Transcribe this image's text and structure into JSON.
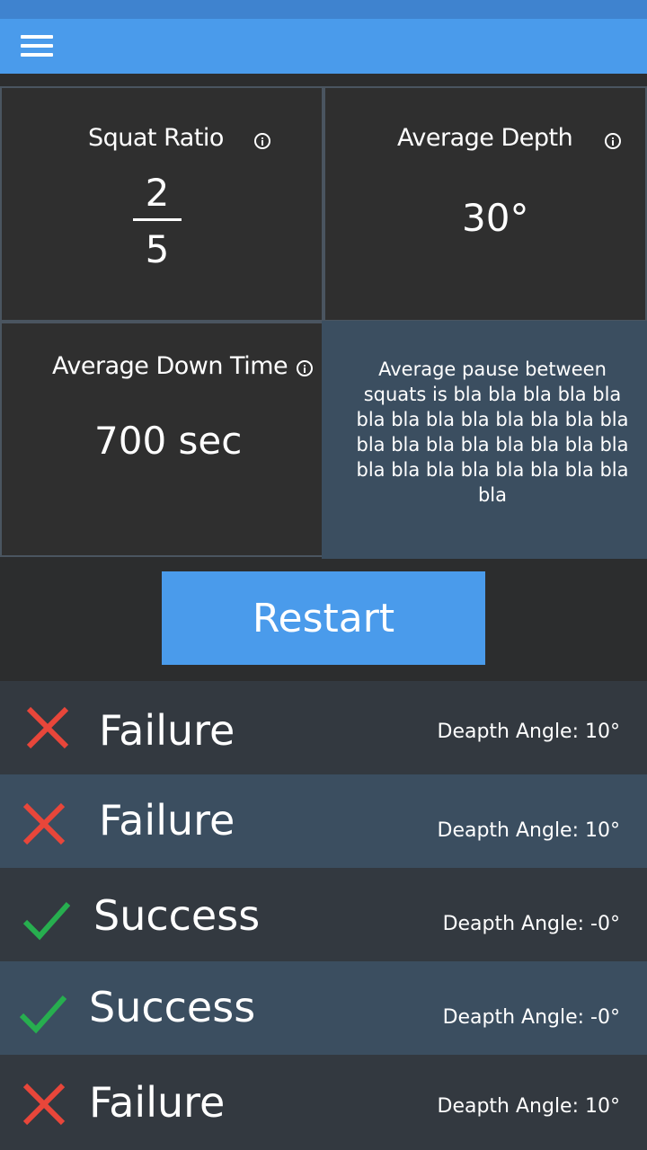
{
  "colors": {
    "app_bar": "#4a9beb",
    "status_bar": "#3f83cf",
    "background": "#2e2f30",
    "tile_border": "#4a5560",
    "row_dark": "#333940",
    "row_light": "#3b4e60",
    "failure": "#e8463a",
    "success": "#27ae4f"
  },
  "header": {
    "menu_icon": "hamburger-icon"
  },
  "stats": {
    "squat_ratio": {
      "title": "Squat Ratio",
      "numerator": "2",
      "denominator": "5",
      "icon": "info-icon"
    },
    "average_depth": {
      "title": "Average Depth",
      "value": "30°",
      "icon": "info-icon"
    },
    "average_down_time": {
      "title": "Average Down Time",
      "value": "700 sec",
      "icon": "info-icon"
    },
    "pause_text": "Average pause between squats is bla bla bla bla bla bla bla bla bla bla bla bla bla bla bla bla bla bla bla bla bla bla bla bla bla bla bla bla bla bla"
  },
  "restart": {
    "label": "Restart"
  },
  "results": [
    {
      "status": "Failure",
      "icon": "cross-icon",
      "angle": "Deapth Angle: 10°"
    },
    {
      "status": "Failure",
      "icon": "cross-icon",
      "angle": "Deapth Angle: 10°"
    },
    {
      "status": "Success",
      "icon": "check-icon",
      "angle": "Deapth Angle: -0°"
    },
    {
      "status": "Success",
      "icon": "check-icon",
      "angle": "Deapth Angle: -0°"
    },
    {
      "status": "Failure",
      "icon": "cross-icon",
      "angle": "Deapth Angle: 10°"
    }
  ]
}
